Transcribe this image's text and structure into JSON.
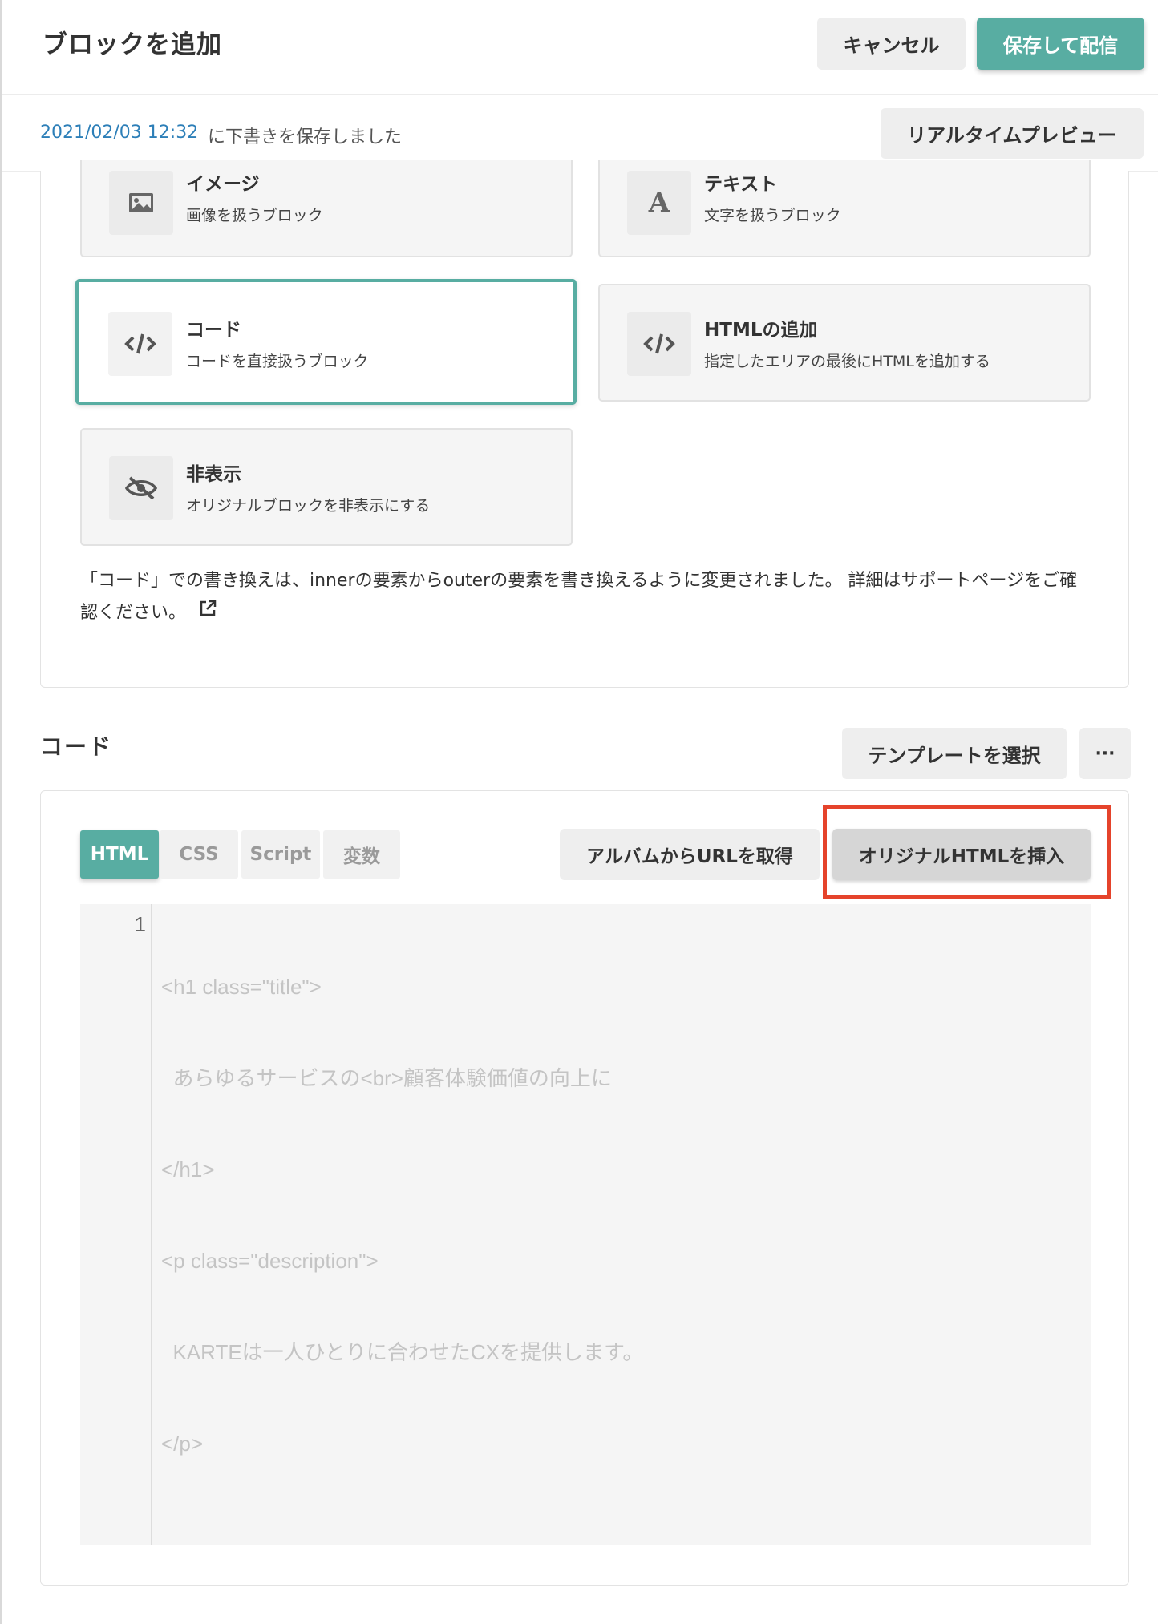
{
  "header": {
    "title": "ブロックを追加",
    "cancel_label": "キャンセル",
    "save_publish_label": "保存して配信"
  },
  "save_status": {
    "timestamp": "2021/02/03 12:32",
    "message": "に下書きを保存しました",
    "preview_label": "リアルタイムプレビュー"
  },
  "block_types": [
    {
      "title": "イメージ",
      "description": "画像を扱うブロック",
      "icon": "image-icon"
    },
    {
      "title": "テキスト",
      "description": "文字を扱うブロック",
      "icon": "text-a-icon"
    },
    {
      "title": "コード",
      "description": "コードを直接扱うブロック",
      "icon": "code-icon",
      "selected": true
    },
    {
      "title": "HTMLの追加",
      "description": "指定したエリアの最後にHTMLを追加する",
      "icon": "code-icon"
    },
    {
      "title": "非表示",
      "description": "オリジナルブロックを非表示にする",
      "icon": "eye-off-icon"
    }
  ],
  "notice": {
    "text": "「コード」での書き換えは、innerの要素からouterの要素を書き換えるように変更されました。 詳細はサポートページをご確認ください。",
    "link_icon": "external-link-icon"
  },
  "code_section": {
    "title": "コード",
    "template_label": "テンプレートを選択",
    "more_label": "···",
    "tabs": [
      "HTML",
      "CSS",
      "Script",
      "変数"
    ],
    "active_tab": "HTML",
    "album_url_label": "アルバムからURLを取得",
    "insert_original_label": "オリジナルHTMLを挿入"
  },
  "editor": {
    "line_numbers": [
      "1"
    ],
    "lines": [
      "<h1 class=\"title\">",
      "  あらゆるサービスの<br>顧客体験価値の向上に",
      "</h1>",
      "<p class=\"description\">",
      "  KARTEは一人ひとりに合わせたCXを提供します。",
      "</p>"
    ]
  },
  "colors": {
    "accent": "#58ada2",
    "highlight_border": "#e5432b",
    "timestamp_link": "#2d7fb8"
  }
}
